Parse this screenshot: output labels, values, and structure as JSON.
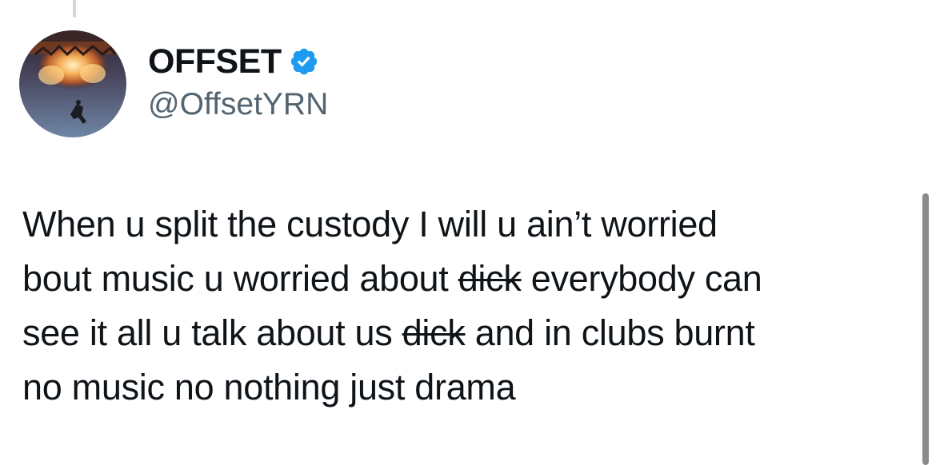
{
  "user": {
    "display_name": "OFFSET",
    "handle": "@OffsetYRN",
    "verified": true,
    "verified_color": "#1d9bf0",
    "avatar_icon": "avatar-image"
  },
  "tweet": {
    "line1": "When u split the custody I will u ain’t worried",
    "line2_a": "bout music u worried about ",
    "line2_strike": "dick",
    "line2_b": " everybody can",
    "line3_a": "see it all u talk about us ",
    "line3_strike": "dick",
    "line3_b": " and in clubs burnt",
    "line4": "no music no nothing just drama"
  },
  "colors": {
    "text": "#0f1419",
    "secondary": "#536471",
    "thread_line": "#cfd9de"
  }
}
